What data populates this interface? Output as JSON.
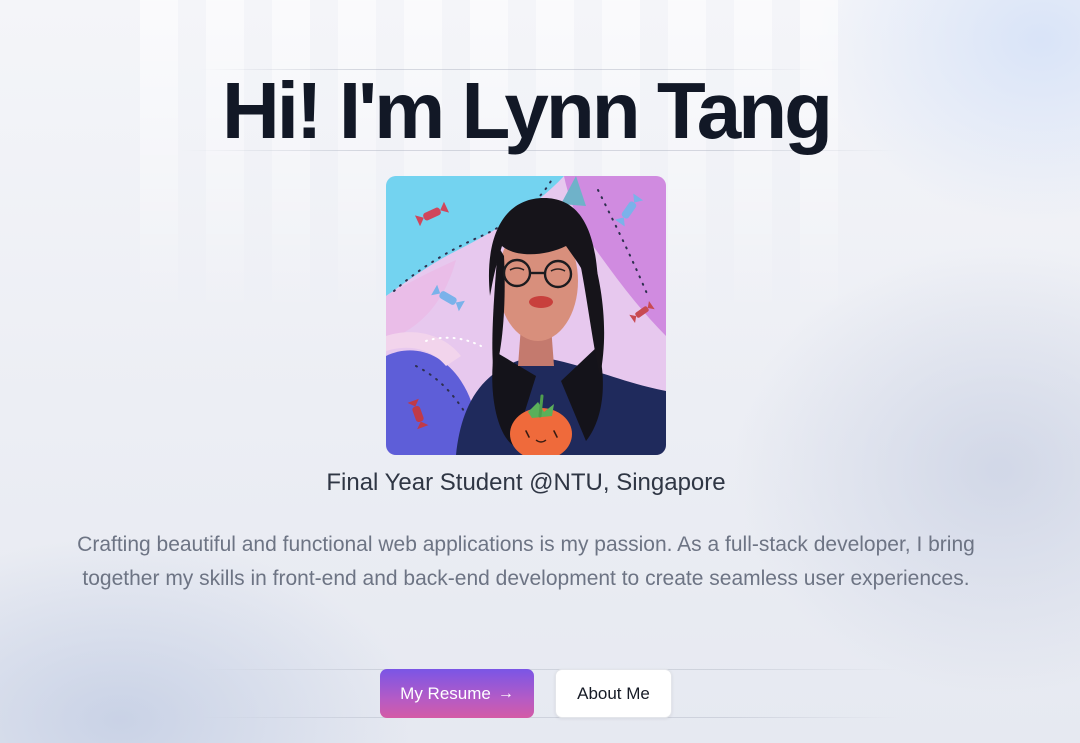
{
  "hero": {
    "title": "Hi! I'm Lynn Tang",
    "subtitle": "Final Year Student @NTU, Singapore",
    "description": "Crafting beautiful and functional web applications is my passion. As a full-stack developer, I bring together my skills in front-end and back-end development to create seamless user experiences."
  },
  "buttons": {
    "resume_label": "My Resume",
    "resume_icon": "arrow-right-icon",
    "about_label": "About Me"
  },
  "colors": {
    "title": "#121826",
    "primary_gradient_start": "#7a55e6",
    "primary_gradient_end": "#d45ba6",
    "secondary_bg": "#ffffff"
  }
}
